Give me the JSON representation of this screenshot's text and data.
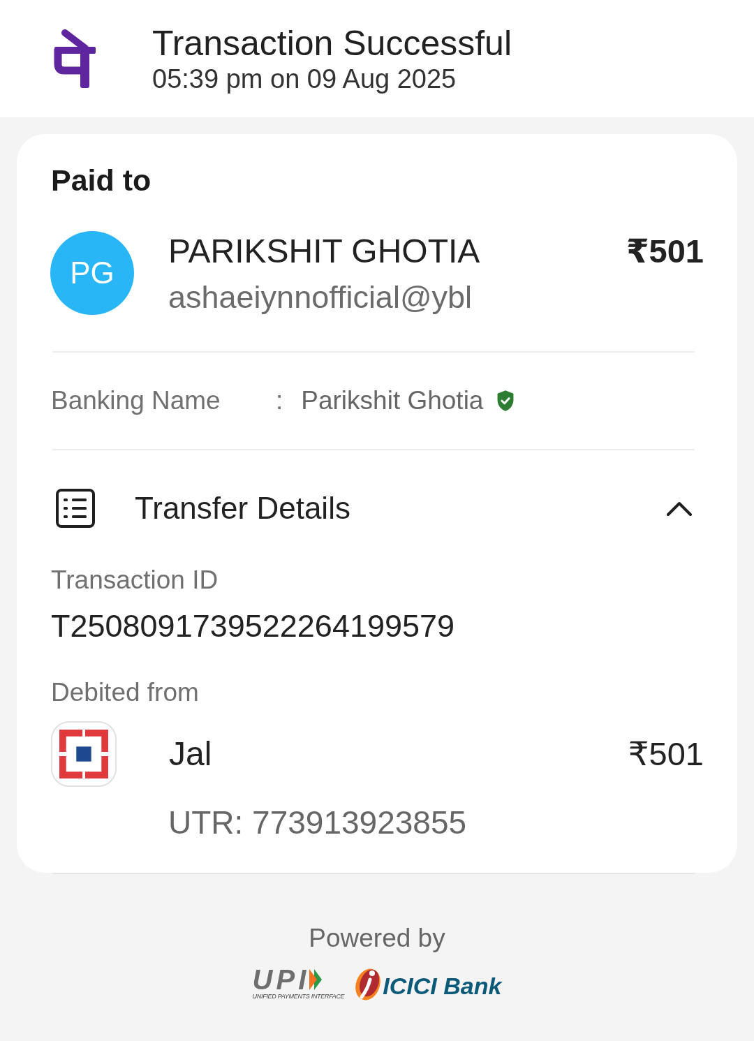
{
  "header": {
    "title": "Transaction Successful",
    "timestamp": "05:39 pm on 09 Aug 2025"
  },
  "paid_to": {
    "heading": "Paid to",
    "payee": {
      "initials": "PG",
      "name": "PARIKSHIT GHOTIA",
      "upi_id": "ashaeiynnofficial@ybl",
      "amount": "₹501"
    }
  },
  "banking_name": {
    "label": "Banking Name",
    "separator": ":",
    "value": "Parikshit Ghotia",
    "verified": true
  },
  "transfer_details": {
    "title": "Transfer Details",
    "expanded": true,
    "transaction_id": {
      "label": "Transaction ID",
      "value": "T2508091739522264199579"
    },
    "debited_from": {
      "label": "Debited from",
      "account": "Jal",
      "amount": "₹501",
      "utr": "UTR: 773913923855"
    }
  },
  "footer": {
    "powered_by": "Powered by",
    "logos": [
      {
        "kind": "upi",
        "name": "UPI",
        "tagline": "UNIFIED PAYMENTS INTERFACE"
      },
      {
        "kind": "bank",
        "name": "ICICI Bank"
      }
    ]
  }
}
